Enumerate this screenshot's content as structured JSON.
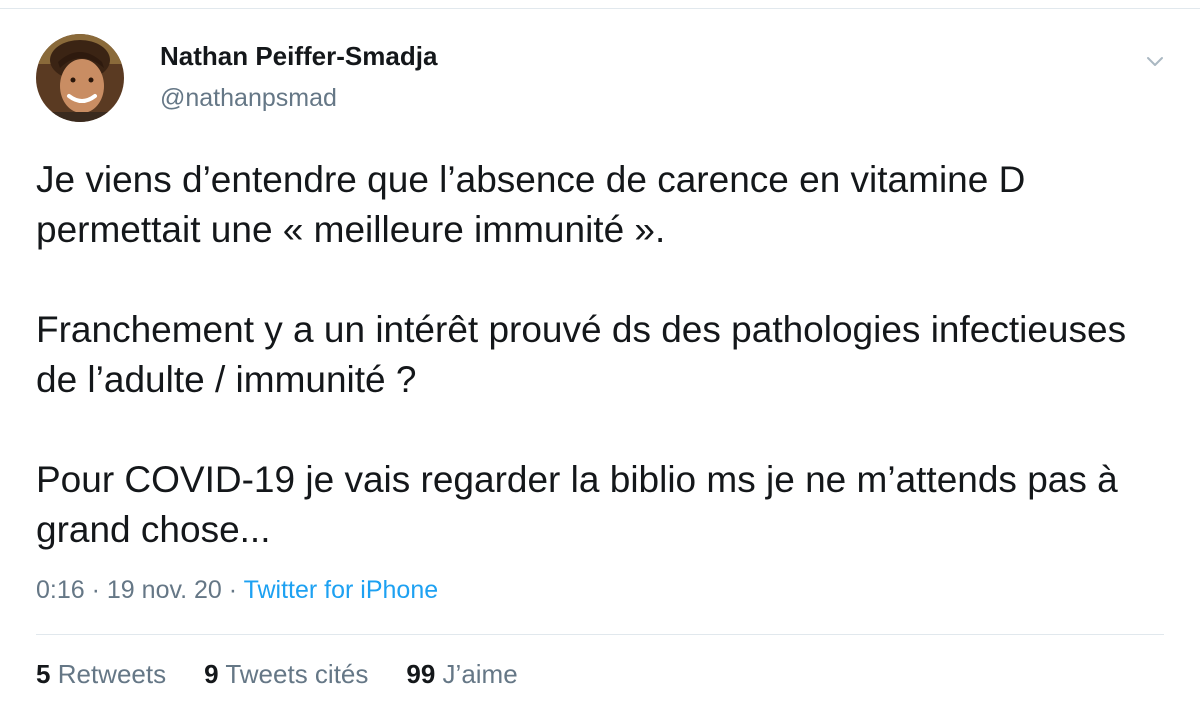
{
  "tweet": {
    "author": {
      "display_name": "Nathan Peiffer-Smadja",
      "username": "@nathanpsmad",
      "avatar_icon": "profile-photo"
    },
    "menu_icon": "chevron-down-icon",
    "paragraphs": [
      "Je viens d’entendre que l’absence de carence en vitamine D permettait une « meilleure immunité ».",
      "Franchement y a un intérêt prouvé ds des pathologies infectieuses de l’adulte / immunité ?",
      "Pour COVID-19 je vais regarder la biblio ms je ne m’attends pas à grand chose..."
    ],
    "meta": {
      "time": "0:16",
      "separator": "·",
      "date": "19 nov. 20",
      "source": "Twitter for iPhone"
    },
    "stats": {
      "retweets_count": "5",
      "retweets_label": "Retweets",
      "quotes_count": "9",
      "quotes_label": "Tweets cités",
      "likes_count": "99",
      "likes_label": "J’aime"
    }
  },
  "colors": {
    "text_primary": "#14171a",
    "text_secondary": "#657786",
    "link": "#1da1f2",
    "divider": "#e1e8ed"
  }
}
